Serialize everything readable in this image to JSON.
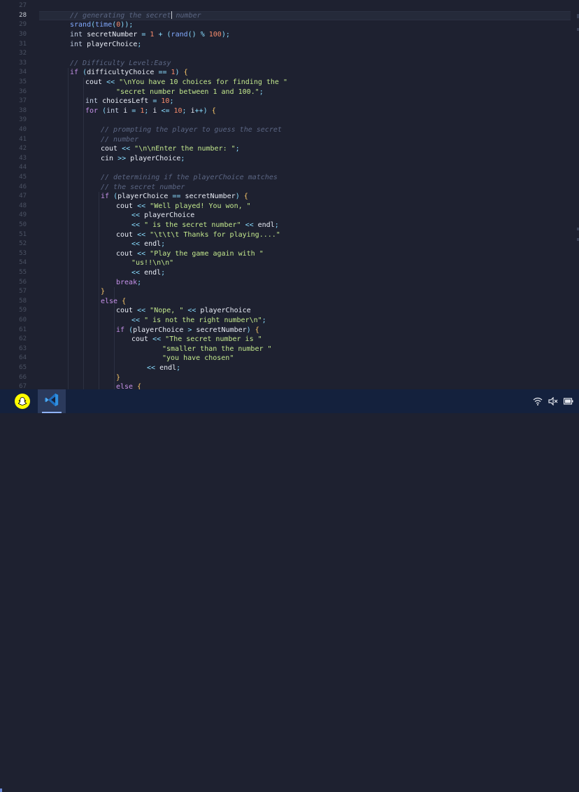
{
  "editor": {
    "line_numbers": [
      "27",
      "28",
      "29",
      "30",
      "31",
      "32",
      "33",
      "34",
      "35",
      "36",
      "37",
      "38",
      "39",
      "40",
      "41",
      "42",
      "43",
      "44",
      "45",
      "46",
      "47",
      "48",
      "49",
      "50",
      "51",
      "52",
      "53",
      "54",
      "55",
      "56",
      "57",
      "58",
      "59",
      "60",
      "61",
      "62",
      "63",
      "64",
      "65",
      "66",
      "67"
    ],
    "current_line": "28",
    "lines": [
      {
        "indent": 0,
        "tokens": [
          {
            "c": "t-comment",
            "t": "// generating the secret"
          },
          {
            "c": "cursor",
            "t": ""
          },
          {
            "c": "t-comment",
            "t": " number"
          }
        ]
      },
      {
        "indent": 0,
        "tokens": [
          {
            "c": "t-func",
            "t": "srand"
          },
          {
            "c": "t-punct",
            "t": "("
          },
          {
            "c": "t-func",
            "t": "time"
          },
          {
            "c": "t-punct",
            "t": "("
          },
          {
            "c": "t-number",
            "t": "0"
          },
          {
            "c": "t-punct",
            "t": "));"
          }
        ]
      },
      {
        "indent": 0,
        "tokens": [
          {
            "c": "t-type",
            "t": "int "
          },
          {
            "c": "t-ident",
            "t": "secretNumber "
          },
          {
            "c": "t-op",
            "t": "= "
          },
          {
            "c": "t-number",
            "t": "1 "
          },
          {
            "c": "t-op",
            "t": "+ "
          },
          {
            "c": "t-punct",
            "t": "("
          },
          {
            "c": "t-func",
            "t": "rand"
          },
          {
            "c": "t-punct",
            "t": "() "
          },
          {
            "c": "t-op",
            "t": "% "
          },
          {
            "c": "t-number",
            "t": "100"
          },
          {
            "c": "t-punct",
            "t": ");"
          }
        ]
      },
      {
        "indent": 0,
        "tokens": [
          {
            "c": "t-type",
            "t": "int "
          },
          {
            "c": "t-ident",
            "t": "playerChoice"
          },
          {
            "c": "t-punct",
            "t": ";"
          }
        ]
      },
      {
        "indent": 0,
        "tokens": []
      },
      {
        "indent": 0,
        "tokens": [
          {
            "c": "t-comment",
            "t": "// Difficulty Level:Easy"
          }
        ]
      },
      {
        "indent": 0,
        "tokens": [
          {
            "c": "t-keyword",
            "t": "if "
          },
          {
            "c": "t-punct",
            "t": "("
          },
          {
            "c": "t-ident",
            "t": "difficultyChoice "
          },
          {
            "c": "t-op",
            "t": "== "
          },
          {
            "c": "t-number",
            "t": "1"
          },
          {
            "c": "t-punct",
            "t": ") "
          },
          {
            "c": "t-brace",
            "t": "{"
          }
        ]
      },
      {
        "indent": 1,
        "tokens": [
          {
            "c": "t-ident",
            "t": "cout "
          },
          {
            "c": "t-op",
            "t": "<< "
          },
          {
            "c": "t-string",
            "t": "\"\\nYou have 10 choices for finding the \""
          }
        ]
      },
      {
        "indent": 3,
        "tokens": [
          {
            "c": "t-string",
            "t": "\"secret number between 1 and 100.\""
          },
          {
            "c": "t-punct",
            "t": ";"
          }
        ]
      },
      {
        "indent": 1,
        "tokens": [
          {
            "c": "t-type",
            "t": "int "
          },
          {
            "c": "t-ident",
            "t": "choicesLeft "
          },
          {
            "c": "t-op",
            "t": "= "
          },
          {
            "c": "t-number",
            "t": "10"
          },
          {
            "c": "t-punct",
            "t": ";"
          }
        ]
      },
      {
        "indent": 1,
        "tokens": [
          {
            "c": "t-keyword",
            "t": "for "
          },
          {
            "c": "t-punct",
            "t": "("
          },
          {
            "c": "t-type",
            "t": "int "
          },
          {
            "c": "t-ident",
            "t": "i "
          },
          {
            "c": "t-op",
            "t": "= "
          },
          {
            "c": "t-number",
            "t": "1"
          },
          {
            "c": "t-punct",
            "t": "; "
          },
          {
            "c": "t-ident",
            "t": "i "
          },
          {
            "c": "t-op",
            "t": "<= "
          },
          {
            "c": "t-number",
            "t": "10"
          },
          {
            "c": "t-punct",
            "t": "; "
          },
          {
            "c": "t-ident",
            "t": "i"
          },
          {
            "c": "t-op",
            "t": "++"
          },
          {
            "c": "t-punct",
            "t": ") "
          },
          {
            "c": "t-brace",
            "t": "{"
          }
        ]
      },
      {
        "indent": 0,
        "tokens": []
      },
      {
        "indent": 2,
        "tokens": [
          {
            "c": "t-comment",
            "t": "// prompting the player to guess the secret"
          }
        ]
      },
      {
        "indent": 2,
        "tokens": [
          {
            "c": "t-comment",
            "t": "// number"
          }
        ]
      },
      {
        "indent": 2,
        "tokens": [
          {
            "c": "t-ident",
            "t": "cout "
          },
          {
            "c": "t-op",
            "t": "<< "
          },
          {
            "c": "t-string",
            "t": "\"\\n\\nEnter the number: \""
          },
          {
            "c": "t-punct",
            "t": ";"
          }
        ]
      },
      {
        "indent": 2,
        "tokens": [
          {
            "c": "t-ident",
            "t": "cin "
          },
          {
            "c": "t-op",
            "t": ">> "
          },
          {
            "c": "t-ident",
            "t": "playerChoice"
          },
          {
            "c": "t-punct",
            "t": ";"
          }
        ]
      },
      {
        "indent": 0,
        "tokens": []
      },
      {
        "indent": 2,
        "tokens": [
          {
            "c": "t-comment",
            "t": "// determining if the playerChoice matches"
          }
        ]
      },
      {
        "indent": 2,
        "tokens": [
          {
            "c": "t-comment",
            "t": "// the secret number"
          }
        ]
      },
      {
        "indent": 2,
        "tokens": [
          {
            "c": "t-keyword",
            "t": "if "
          },
          {
            "c": "t-punct",
            "t": "("
          },
          {
            "c": "t-ident",
            "t": "playerChoice "
          },
          {
            "c": "t-op",
            "t": "== "
          },
          {
            "c": "t-ident",
            "t": "secretNumber"
          },
          {
            "c": "t-punct",
            "t": ") "
          },
          {
            "c": "t-brace",
            "t": "{"
          }
        ]
      },
      {
        "indent": 3,
        "tokens": [
          {
            "c": "t-ident",
            "t": "cout "
          },
          {
            "c": "t-op",
            "t": "<< "
          },
          {
            "c": "t-string",
            "t": "\"Well played! You won, \""
          }
        ]
      },
      {
        "indent": 4,
        "tokens": [
          {
            "c": "t-op",
            "t": "<< "
          },
          {
            "c": "t-ident",
            "t": "playerChoice"
          }
        ]
      },
      {
        "indent": 4,
        "tokens": [
          {
            "c": "t-op",
            "t": "<< "
          },
          {
            "c": "t-string",
            "t": "\" is the secret number\" "
          },
          {
            "c": "t-op",
            "t": "<< "
          },
          {
            "c": "t-ident",
            "t": "endl"
          },
          {
            "c": "t-punct",
            "t": ";"
          }
        ]
      },
      {
        "indent": 3,
        "tokens": [
          {
            "c": "t-ident",
            "t": "cout "
          },
          {
            "c": "t-op",
            "t": "<< "
          },
          {
            "c": "t-string",
            "t": "\"\\t\\t\\t Thanks for playing....\""
          }
        ]
      },
      {
        "indent": 4,
        "tokens": [
          {
            "c": "t-op",
            "t": "<< "
          },
          {
            "c": "t-ident",
            "t": "endl"
          },
          {
            "c": "t-punct",
            "t": ";"
          }
        ]
      },
      {
        "indent": 3,
        "tokens": [
          {
            "c": "t-ident",
            "t": "cout "
          },
          {
            "c": "t-op",
            "t": "<< "
          },
          {
            "c": "t-string",
            "t": "\"Play the game again with \""
          }
        ]
      },
      {
        "indent": 4,
        "tokens": [
          {
            "c": "t-string",
            "t": "\"us!!\\n\\n\""
          }
        ]
      },
      {
        "indent": 4,
        "tokens": [
          {
            "c": "t-op",
            "t": "<< "
          },
          {
            "c": "t-ident",
            "t": "endl"
          },
          {
            "c": "t-punct",
            "t": ";"
          }
        ]
      },
      {
        "indent": 3,
        "tokens": [
          {
            "c": "t-keyword",
            "t": "break"
          },
          {
            "c": "t-punct",
            "t": ";"
          }
        ]
      },
      {
        "indent": 2,
        "tokens": [
          {
            "c": "t-brace",
            "t": "}"
          }
        ]
      },
      {
        "indent": 2,
        "tokens": [
          {
            "c": "t-keyword",
            "t": "else "
          },
          {
            "c": "t-brace",
            "t": "{"
          }
        ]
      },
      {
        "indent": 3,
        "tokens": [
          {
            "c": "t-ident",
            "t": "cout "
          },
          {
            "c": "t-op",
            "t": "<< "
          },
          {
            "c": "t-string",
            "t": "\"Nope, \" "
          },
          {
            "c": "t-op",
            "t": "<< "
          },
          {
            "c": "t-ident",
            "t": "playerChoice"
          }
        ]
      },
      {
        "indent": 4,
        "tokens": [
          {
            "c": "t-op",
            "t": "<< "
          },
          {
            "c": "t-string",
            "t": "\" is not the right number\\n\""
          },
          {
            "c": "t-punct",
            "t": ";"
          }
        ]
      },
      {
        "indent": 3,
        "tokens": [
          {
            "c": "t-keyword",
            "t": "if "
          },
          {
            "c": "t-punct",
            "t": "("
          },
          {
            "c": "t-ident",
            "t": "playerChoice "
          },
          {
            "c": "t-op",
            "t": "> "
          },
          {
            "c": "t-ident",
            "t": "secretNumber"
          },
          {
            "c": "t-punct",
            "t": ") "
          },
          {
            "c": "t-brace",
            "t": "{"
          }
        ]
      },
      {
        "indent": 4,
        "tokens": [
          {
            "c": "t-ident",
            "t": "cout "
          },
          {
            "c": "t-op",
            "t": "<< "
          },
          {
            "c": "t-string",
            "t": "\"The secret number is \""
          }
        ]
      },
      {
        "indent": 6,
        "tokens": [
          {
            "c": "t-string",
            "t": "\"smaller than the number \""
          }
        ]
      },
      {
        "indent": 6,
        "tokens": [
          {
            "c": "t-string",
            "t": "\"you have chosen\""
          }
        ]
      },
      {
        "indent": 5,
        "tokens": [
          {
            "c": "t-op",
            "t": "<< "
          },
          {
            "c": "t-ident",
            "t": "endl"
          },
          {
            "c": "t-punct",
            "t": ";"
          }
        ]
      },
      {
        "indent": 3,
        "tokens": [
          {
            "c": "t-brace",
            "t": "}"
          }
        ]
      },
      {
        "indent": 3,
        "tokens": [
          {
            "c": "t-keyword",
            "t": "else "
          },
          {
            "c": "t-brace",
            "t": "{"
          }
        ]
      }
    ]
  },
  "taskbar": {
    "apps": [
      {
        "name": "snapchat-icon"
      },
      {
        "name": "vscode-icon",
        "active": true
      }
    ],
    "tray": {
      "wifi_icon": "wifi-icon",
      "volume_icon": "volume-muted-icon",
      "battery_icon": "battery-icon"
    }
  },
  "colors": {
    "editor_bg": "#1e2130",
    "taskbar_bg": "#14213d",
    "comment": "#5c6784",
    "keyword": "#c792ea",
    "string": "#c3e88d",
    "number": "#f78c6c",
    "function": "#82aaff"
  }
}
